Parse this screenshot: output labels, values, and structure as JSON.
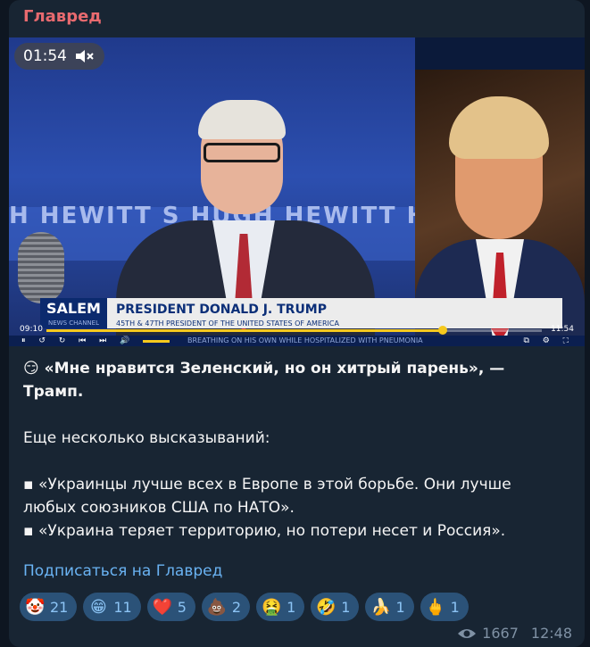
{
  "channel": {
    "name": "Главред"
  },
  "video": {
    "duration_badge": "01:54",
    "volume_icon": "speaker-muted-icon",
    "wall_text": "H HEWITT  S  HUGH HEWITT  HUGH HEWITT  S  HU",
    "network_logo": "SALEM",
    "network_sub": "NEWS CHANNEL",
    "lower_third_title": "PRESIDENT DONALD J. TRUMP",
    "lower_third_sub": "45TH & 47TH PRESIDENT OF THE UNITED STATES OF AMERICA",
    "ticker": "BREATHING ON HIS OWN WHILE HOSPITALIZED WITH PNEUMONIA",
    "time_current": "09:10",
    "time_total": "11:54",
    "progress": 0.8,
    "controls_left": "⏸ ↺ ↻ ⏮ ⏭ 🔊",
    "controls_right": "⧉ ⚙ ⛶"
  },
  "message": {
    "headline_emoji": "😏",
    "headline": "«Мне нравится Зеленский, но он хитрый парень», — Трамп.",
    "intro": "Еще несколько высказываний:",
    "bullet_icon": "▪",
    "quote1": "«Украинцы лучше всех в Европе в этой борьбе. Они лучше любых союзников США по НАТО».",
    "quote2": "«Украина теряет территорию, но потери несет и Россия».",
    "subscribe_link": "Подписаться на Главред"
  },
  "reactions": [
    {
      "emoji": "🤡",
      "count": "21"
    },
    {
      "emoji": "😁",
      "count": "11"
    },
    {
      "emoji": "❤️",
      "count": "5"
    },
    {
      "emoji": "💩",
      "count": "2"
    },
    {
      "emoji": "🤮",
      "count": "1"
    },
    {
      "emoji": "🤣",
      "count": "1"
    },
    {
      "emoji": "🍌",
      "count": "1"
    },
    {
      "emoji": "🖕",
      "count": "1"
    }
  ],
  "meta": {
    "views": "1667",
    "time": "12:48",
    "views_icon": "eye-icon"
  }
}
